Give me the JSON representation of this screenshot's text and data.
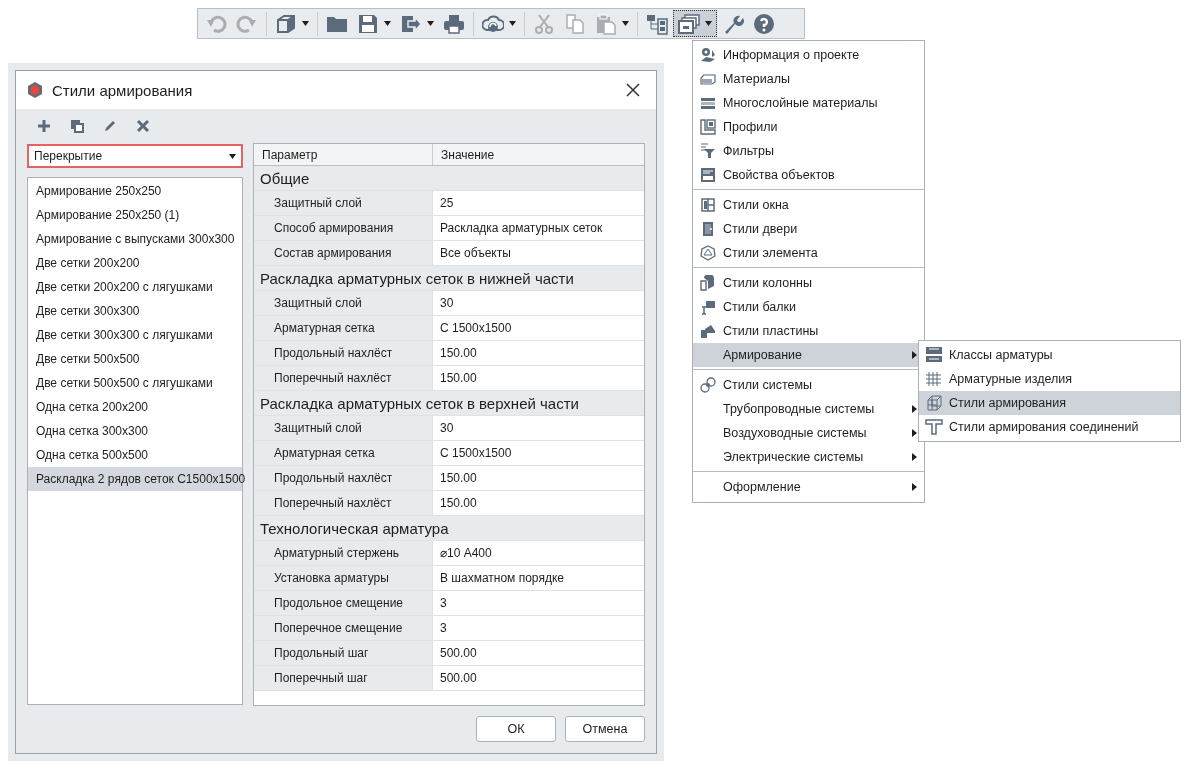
{
  "toolbar": {
    "items": [
      {
        "kind": "button",
        "disabled": true,
        "dropdown": false,
        "selected": false
      },
      {
        "kind": "button",
        "disabled": true,
        "dropdown": false,
        "selected": false
      },
      {
        "kind": "separator"
      },
      {
        "kind": "button",
        "disabled": false,
        "dropdown": true,
        "selected": false
      },
      {
        "kind": "separator"
      },
      {
        "kind": "button",
        "disabled": false,
        "dropdown": false,
        "selected": false
      },
      {
        "kind": "button",
        "disabled": false,
        "dropdown": true,
        "selected": false
      },
      {
        "kind": "button",
        "disabled": false,
        "dropdown": true,
        "selected": false
      },
      {
        "kind": "button",
        "disabled": false,
        "dropdown": false,
        "selected": false
      },
      {
        "kind": "separator"
      },
      {
        "kind": "button",
        "disabled": false,
        "dropdown": true,
        "selected": false
      },
      {
        "kind": "separator"
      },
      {
        "kind": "button",
        "disabled": true,
        "dropdown": false,
        "selected": false
      },
      {
        "kind": "button",
        "disabled": true,
        "dropdown": false,
        "selected": false
      },
      {
        "kind": "button",
        "disabled": true,
        "dropdown": true,
        "selected": false
      },
      {
        "kind": "separator"
      },
      {
        "kind": "button",
        "disabled": false,
        "dropdown": false,
        "selected": false
      },
      {
        "kind": "button",
        "disabled": false,
        "dropdown": true,
        "selected": true
      },
      {
        "kind": "button",
        "disabled": false,
        "dropdown": false,
        "selected": false
      },
      {
        "kind": "button",
        "disabled": false,
        "dropdown": false,
        "selected": false
      }
    ]
  },
  "menu": {
    "groups": [
      {
        "items": [
          {
            "label": "Информация о проекте",
            "selected": false,
            "has_submenu": false
          },
          {
            "label": "Материалы",
            "selected": false,
            "has_submenu": false
          },
          {
            "label": "Многослойные материалы",
            "selected": false,
            "has_submenu": false
          },
          {
            "label": "Профили",
            "selected": false,
            "has_submenu": false
          },
          {
            "label": "Фильтры",
            "selected": false,
            "has_submenu": false
          },
          {
            "label": "Свойства объектов",
            "selected": false,
            "has_submenu": false
          }
        ]
      },
      {
        "items": [
          {
            "label": "Стили окна",
            "selected": false,
            "has_submenu": false
          },
          {
            "label": "Стили двери",
            "selected": false,
            "has_submenu": false
          },
          {
            "label": "Стили элемента",
            "selected": false,
            "has_submenu": false
          }
        ]
      },
      {
        "items": [
          {
            "label": "Стили колонны",
            "selected": false,
            "has_submenu": false
          },
          {
            "label": "Стили балки",
            "selected": false,
            "has_submenu": false
          },
          {
            "label": "Стили пластины",
            "selected": false,
            "has_submenu": false
          },
          {
            "label": "Армирование",
            "selected": true,
            "has_submenu": true,
            "submenu": [
              {
                "label": "Классы арматуры",
                "selected": false
              },
              {
                "label": "Арматурные изделия",
                "selected": false
              },
              {
                "label": "Стили армирования",
                "selected": true
              },
              {
                "label": "Стили армирования соединений",
                "selected": false
              }
            ]
          }
        ]
      },
      {
        "items": [
          {
            "label": "Стили системы",
            "selected": false,
            "has_submenu": false
          },
          {
            "label": "Трубопроводные системы",
            "selected": false,
            "has_submenu": true
          },
          {
            "label": "Воздуховодные системы",
            "selected": false,
            "has_submenu": true
          },
          {
            "label": "Электрические системы",
            "selected": false,
            "has_submenu": true
          }
        ]
      },
      {
        "items": [
          {
            "label": "Оформление",
            "selected": false,
            "has_submenu": true
          }
        ]
      }
    ]
  },
  "dialog": {
    "title": "Стили армирования",
    "toolbar": [
      {
        "disabled": false
      },
      {
        "disabled": false
      },
      {
        "disabled": false
      },
      {
        "disabled": false
      }
    ],
    "category": {
      "value": "Перекрытие",
      "focused": true
    },
    "styles": [
      {
        "label": "Армирование 250x250",
        "selected": false
      },
      {
        "label": "Армирование 250x250 (1)",
        "selected": false
      },
      {
        "label": "Армирование с выпусками 300x300",
        "selected": false
      },
      {
        "label": "Две сетки 200x200",
        "selected": false
      },
      {
        "label": "Две сетки 200x200 с лягушками",
        "selected": false
      },
      {
        "label": "Две сетки 300x300",
        "selected": false
      },
      {
        "label": "Две сетки 300x300 с лягушками",
        "selected": false
      },
      {
        "label": "Две сетки 500x500",
        "selected": false
      },
      {
        "label": "Две сетки 500x500 с лягушками",
        "selected": false
      },
      {
        "label": "Одна сетка 200x200",
        "selected": false
      },
      {
        "label": "Одна сетка 300x300",
        "selected": false
      },
      {
        "label": "Одна сетка 500x500",
        "selected": false
      },
      {
        "label": "Раскладка 2 рядов сеток С1500x1500",
        "selected": true
      }
    ],
    "table": {
      "columns": [
        "Параметр",
        "Значение"
      ],
      "groups": [
        {
          "title": "Общие",
          "rows": [
            [
              "Защитный слой",
              "25"
            ],
            [
              "Способ армирования",
              "Раскладка арматурных сеток"
            ],
            [
              "Состав армирования",
              "Все объекты"
            ]
          ]
        },
        {
          "title": "Раскладка арматурных сеток в нижней части",
          "rows": [
            [
              "Защитный слой",
              "30"
            ],
            [
              "Арматурная сетка",
              "С 1500x1500"
            ],
            [
              "Продольный нахлёст",
              "150.00"
            ],
            [
              "Поперечный нахлёст",
              "150.00"
            ]
          ]
        },
        {
          "title": "Раскладка арматурных сеток в верхней части",
          "rows": [
            [
              "Защитный слой",
              "30"
            ],
            [
              "Арматурная сетка",
              "С 1500x1500"
            ],
            [
              "Продольный нахлёст",
              "150.00"
            ],
            [
              "Поперечный нахлёст",
              "150.00"
            ]
          ]
        },
        {
          "title": "Технологическая арматура",
          "rows": [
            [
              "Арматурный стержень",
              "⌀10 А400"
            ],
            [
              "Установка арматуры",
              "В шахматном порядке"
            ],
            [
              "Продольное смещение",
              "3"
            ],
            [
              "Поперечное смещение",
              "3"
            ],
            [
              "Продольный шаг",
              "500.00"
            ],
            [
              "Поперечный шаг",
              "500.00"
            ]
          ]
        }
      ]
    },
    "buttons": [
      "ОК",
      "Отмена"
    ]
  }
}
